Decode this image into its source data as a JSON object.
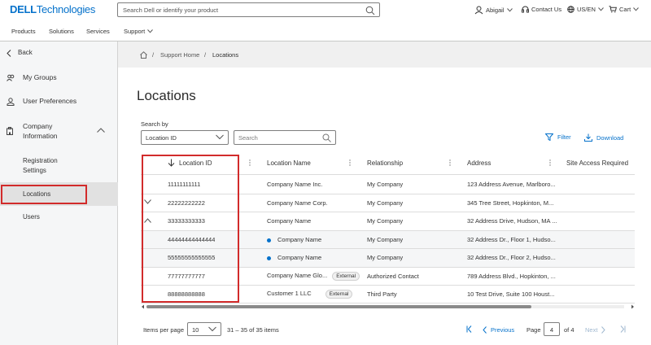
{
  "header": {
    "logo_brand": "DELL",
    "logo_suffix": "Technologies",
    "search_placeholder": "Search Dell or identify your product",
    "user": "Abigail",
    "contact": "Contact Us",
    "locale": "US/EN",
    "cart": "Cart"
  },
  "nav": {
    "products": "Products",
    "solutions": "Solutions",
    "services": "Services",
    "support": "Support"
  },
  "sidebar": {
    "back": "Back",
    "my_groups": "My Groups",
    "user_prefs": "User Preferences",
    "company_info_1": "Company",
    "company_info_2": "Information",
    "reg_settings_1": "Registration",
    "reg_settings_2": "Settings",
    "locations": "Locations",
    "users": "Users"
  },
  "breadcrumb": {
    "home": "Support Home",
    "sep": "/",
    "current": "Locations"
  },
  "page": {
    "title": "Locations",
    "search_by": "Search by",
    "search_by_value": "Location ID",
    "search_placeholder": "Search",
    "filter": "Filter",
    "download": "Download"
  },
  "table": {
    "headers": [
      "Location ID",
      "Location Name",
      "Relationship",
      "Address",
      "Site Access Required"
    ],
    "rows": [
      {
        "id": "11111111111",
        "name": "Company Name Inc.",
        "badge": "",
        "rel": "My Company",
        "addr": "123 Address Avenue, Marlboro..."
      },
      {
        "id": "22222222222",
        "name": "Company Name Corp.",
        "badge": "",
        "rel": "My Company",
        "addr": "345 Tree Street, Hopkinton, M..."
      },
      {
        "id": "33333333333",
        "name": "Company Name",
        "badge": "",
        "rel": "My Company",
        "addr": "32 Address Drive, Hudson, MA ..."
      },
      {
        "id": "44444444444444",
        "name": "Company Name",
        "badge": "",
        "rel": "My Company",
        "addr": "32 Address Dr., Floor 1, Hudso..."
      },
      {
        "id": "55555555555555",
        "name": "Company Name",
        "badge": "",
        "rel": "My Company",
        "addr": "32 Address Dr., Floor 2, Hudso..."
      },
      {
        "id": "77777777777",
        "name": "Company Name Glo...",
        "badge": "External",
        "rel": "Authorized Contact",
        "addr": "789 Address Blvd., Hopkinton, ..."
      },
      {
        "id": "88888888888",
        "name": "Customer 1 LLC",
        "badge": "External",
        "rel": "Third Party",
        "addr": "10 Test Drive, Suite 100 Houst..."
      }
    ]
  },
  "pager": {
    "items_per_page": "Items per page",
    "per_page_value": "10",
    "range": "31 – 35 of 35 items",
    "previous": "Previous",
    "page_label": "Page",
    "page_value": "4",
    "of": "of 4",
    "next": "Next"
  },
  "colors": {
    "accent": "#0672cb",
    "highlight_box": "#d22b2b"
  }
}
